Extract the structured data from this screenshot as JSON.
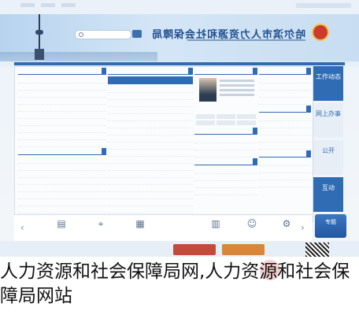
{
  "caption": {
    "text": "人力资源和社会保障局网,人力资源和社会保障局网站"
  },
  "site": {
    "brand_color": "#2f6cb4",
    "title_text": "哈尔滨市人力资源和社会保障局"
  },
  "right_rail": [
    {
      "label": "工作动态"
    },
    {
      "label": "网上办事"
    },
    {
      "label": "公开"
    },
    {
      "label": "互动"
    }
  ],
  "promo": {
    "label": "专题"
  },
  "icons": [
    {
      "name": "document-icon"
    },
    {
      "name": "location-pin-icon"
    },
    {
      "name": "calculator-icon"
    },
    {
      "name": "chart-icon"
    },
    {
      "name": "people-icon"
    },
    {
      "name": "gear-icon"
    }
  ]
}
